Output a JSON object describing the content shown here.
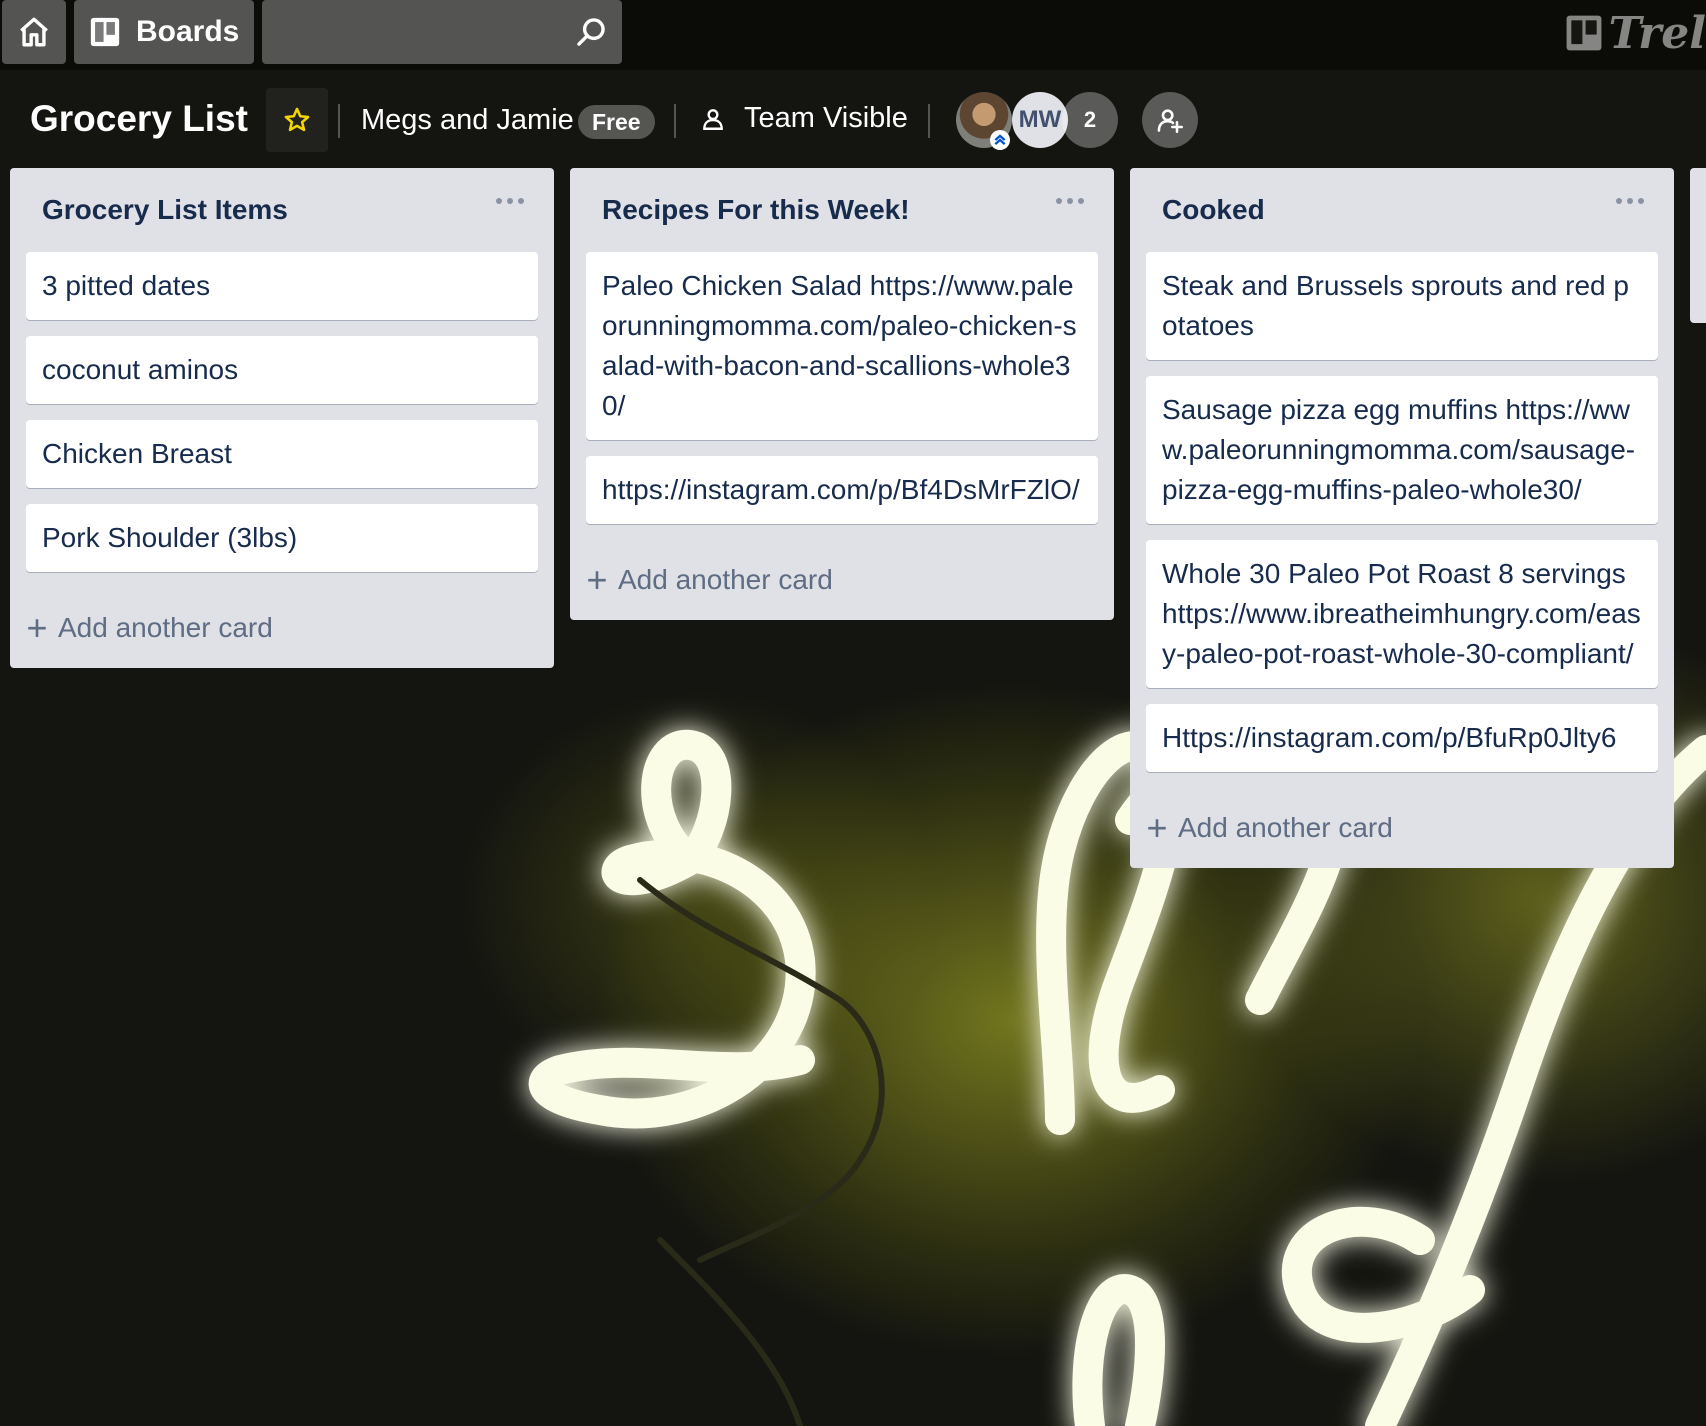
{
  "header": {
    "home_icon": "home-icon",
    "boards_label": "Boards",
    "boards_icon": "boards-icon",
    "search_placeholder": "",
    "search_icon": "search-icon",
    "logo_text": "Trel"
  },
  "board": {
    "title": "Grocery List",
    "starred": false,
    "team_name": "Megs and Jamie",
    "team_badge": "Free",
    "visibility_icon": "team-icon",
    "visibility_label": "Team Visible",
    "members": [
      {
        "type": "photo",
        "initials": ""
      },
      {
        "type": "initials",
        "initials": "MW"
      }
    ],
    "more_members_count": "2",
    "invite_icon": "add-member-icon"
  },
  "lists": [
    {
      "title": "Grocery List Items",
      "cards": [
        "3 pitted dates",
        "coconut aminos",
        "Chicken Breast",
        "Pork Shoulder (3lbs)"
      ],
      "add_label": "Add another card"
    },
    {
      "title": "Recipes For this Week!",
      "cards": [
        "Paleo Chicken Salad https://www.paleorunningmomma.com/paleo-chicken-salad-with-bacon-and-scallions-whole30/",
        "https://instagram.com/p/Bf4DsMrFZlO/"
      ],
      "add_label": "Add another card"
    },
    {
      "title": "Cooked",
      "cards": [
        "Steak and Brussels sprouts and red potatoes",
        "Sausage pizza egg muffins https://www.paleorunningmomma.com/sausage-pizza-egg-muffins-paleo-whole30/",
        "Whole 30 Paleo Pot Roast 8 servings https://www.ibreatheimhungry.com/easy-paleo-pot-roast-whole-30-compliant/",
        "Https://instagram.com/p/BfuRp0Jlty6"
      ],
      "add_label": "Add another card"
    }
  ],
  "colors": {
    "header_bg": "#000000",
    "list_bg": "#dfe1e6",
    "card_bg": "#ffffff",
    "star": "#f2d600",
    "neon": "#f7f8d0"
  }
}
